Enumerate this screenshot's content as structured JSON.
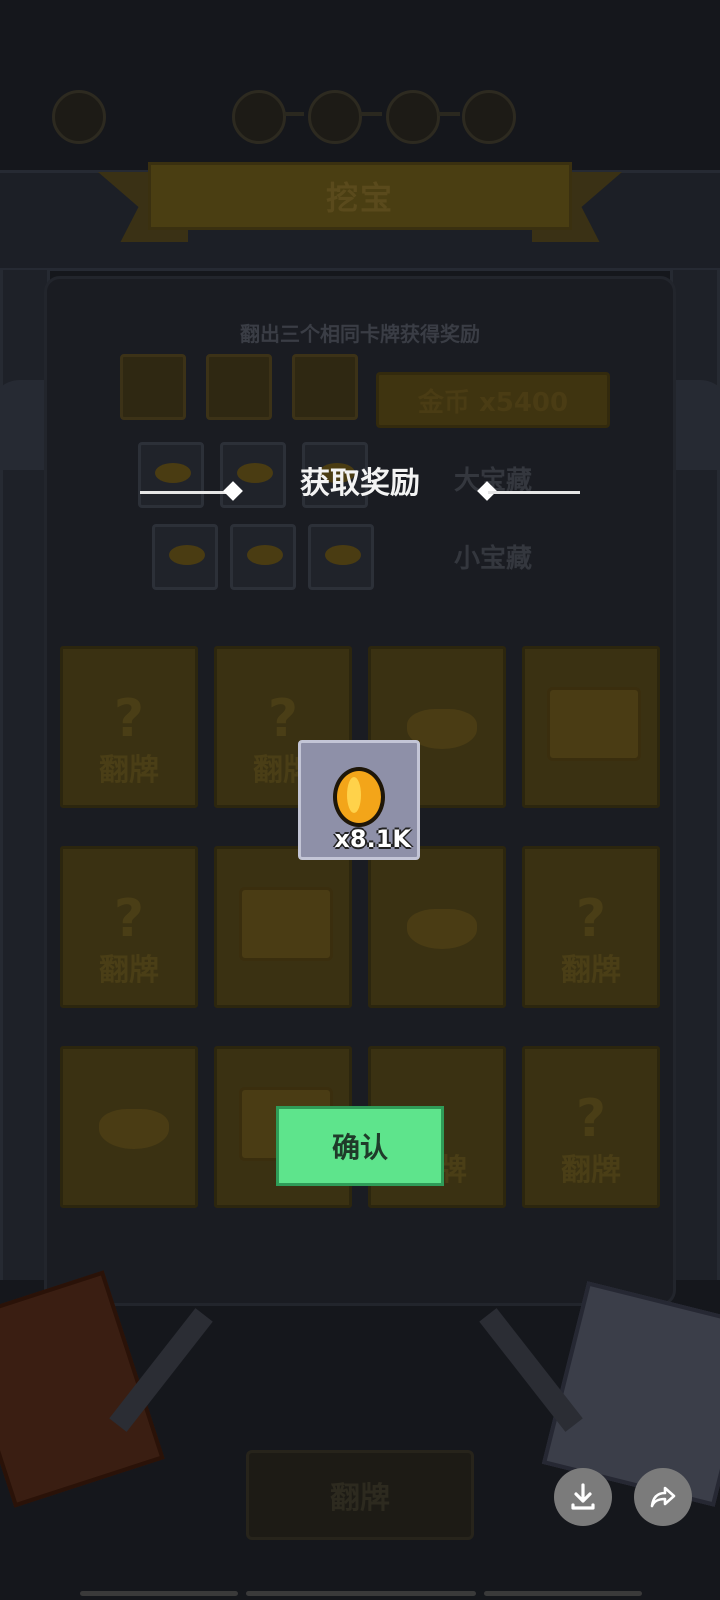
{
  "title": "挖宝",
  "hint": "翻出三个相同卡牌获得奖励",
  "rules": [
    {
      "label": "金币 x5400"
    },
    {
      "label": "大宝藏"
    },
    {
      "label": "小宝藏"
    }
  ],
  "card_flip_text": "翻牌",
  "card_question": "?",
  "overlay": {
    "title": "获取奖励",
    "reward_count": "x8.1K",
    "confirm_label": "确认"
  },
  "bottom_button_label": "翻牌",
  "colors": {
    "confirm": "#5ee48c",
    "coin": "#f3a519",
    "reward_bg": "#8e90a8"
  }
}
